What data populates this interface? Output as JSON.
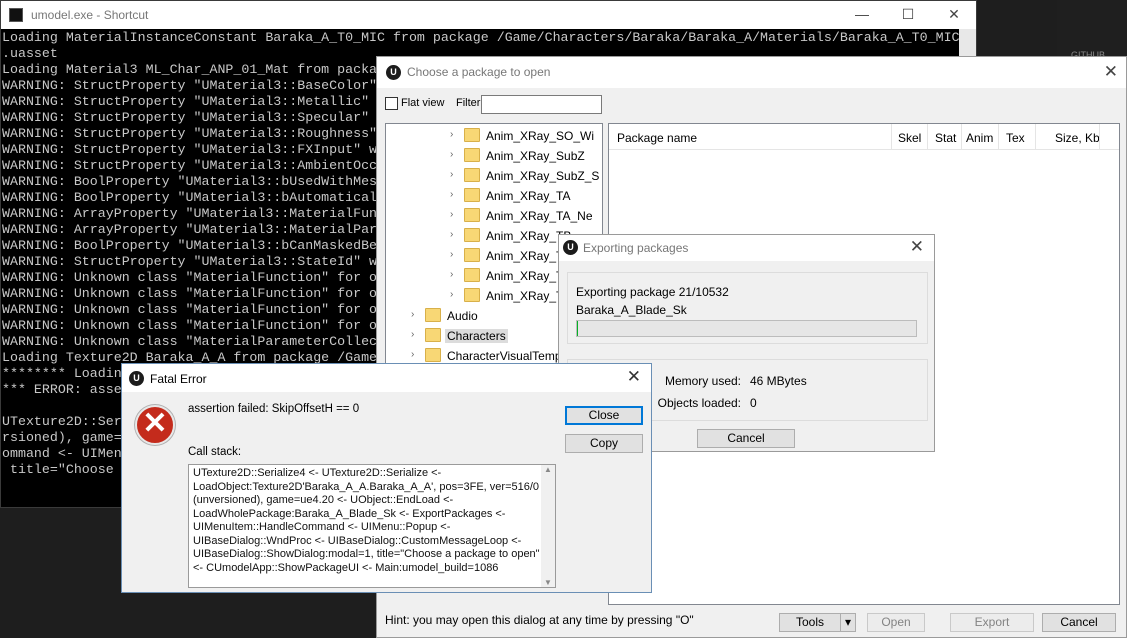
{
  "console": {
    "title": "umodel.exe - Shortcut",
    "controls": {
      "minimize": "—",
      "maximize": "☐",
      "close": "✕"
    },
    "lines": [
      "Loading MaterialInstanceConstant Baraka_A_T0_MIC from package /Game/Characters/Baraka/Baraka_A/Materials/Baraka_A_T0_MIC",
      ".uasset",
      "Loading Material3 ML_Char_ANP_01_Mat from packa",
      "WARNING: StructProperty \"UMaterial3::BaseColor\"",
      "WARNING: StructProperty \"UMaterial3::Metallic\"",
      "WARNING: StructProperty \"UMaterial3::Specular\"",
      "WARNING: StructProperty \"UMaterial3::Roughness\"",
      "WARNING: StructProperty \"UMaterial3::FXInput\" w",
      "WARNING: StructProperty \"UMaterial3::AmbientOcc",
      "WARNING: BoolProperty \"UMaterial3::bUsedWithMes",
      "WARNING: BoolProperty \"UMaterial3::bAutomatical",
      "WARNING: ArrayProperty \"UMaterial3::MaterialFun",
      "WARNING: ArrayProperty \"UMaterial3::MaterialPar",
      "WARNING: BoolProperty \"UMaterial3::bCanMaskedBe",
      "WARNING: StructProperty \"UMaterial3::StateId\" w",
      "WARNING: Unknown class \"MaterialFunction\" for o",
      "WARNING: Unknown class \"MaterialFunction\" for o",
      "WARNING: Unknown class \"MaterialFunction\" for o",
      "WARNING: Unknown class \"MaterialFunction\" for o",
      "WARNING: Unknown class \"MaterialParameterCollec",
      "Loading Texture2D Baraka_A_A from package /Game",
      "******** Loadin",
      "*** ERROR: asse",
      "",
      "UTexture2D::Ser",
      "rsioned), game=",
      "ommand <- UIMen",
      " title=\"Choose"
    ]
  },
  "background": {
    "right_label": "GITHUB"
  },
  "package_dialog": {
    "title": "Choose a package to open",
    "close": "✕",
    "flat_view_label": "Flat view",
    "filter_label": "Filter:",
    "filter_value": "",
    "tree": [
      {
        "label": "Anim_XRay_SO_Wi",
        "level": 1
      },
      {
        "label": "Anim_XRay_SubZ",
        "level": 1
      },
      {
        "label": "Anim_XRay_SubZ_S",
        "level": 1
      },
      {
        "label": "Anim_XRay_TA",
        "level": 1
      },
      {
        "label": "Anim_XRay_TA_Ne",
        "level": 1
      },
      {
        "label": "Anim_XRay_TB",
        "level": 1
      },
      {
        "label": "Anim_XRay_TB",
        "level": 1
      },
      {
        "label": "Anim_XRay_TK",
        "level": 1
      },
      {
        "label": "Anim_XRay_TF",
        "level": 1
      },
      {
        "label": "Audio",
        "level": 0
      },
      {
        "label": "Characters",
        "level": 0,
        "selected": true
      },
      {
        "label": "CharacterVisualTemplat",
        "level": 0
      }
    ],
    "columns": [
      "Package name",
      "Skel",
      "Stat",
      "Anim",
      "Tex",
      "Size, Kb"
    ],
    "hint": "Hint: you may open this dialog at any time by pressing \"O\"",
    "buttons": {
      "tools": "Tools",
      "tools_arrow": "▾",
      "open": "Open",
      "export": "Export",
      "cancel": "Cancel"
    }
  },
  "export_dialog": {
    "title": "Exporting packages",
    "close": "✕",
    "status": "Exporting package 21/10532",
    "current": "Baraka_A_Blade_Sk",
    "progress": 0.002,
    "memory_label": "Memory used:",
    "memory_value": "46 MBytes",
    "objects_label": "Objects loaded:",
    "objects_value": "0",
    "cancel": "Cancel"
  },
  "fatal_dialog": {
    "title": "Fatal Error",
    "close": "✕",
    "message": "assertion failed: SkipOffsetH == 0",
    "callstack_label": "Call stack:",
    "callstack": "UTexture2D::Serialize4 <- UTexture2D::Serialize <-\nLoadObject:Texture2D'Baraka_A_A.Baraka_A_A', pos=3FE, ver=516/0\n(unversioned), game=ue4.20 <- UObject::EndLoad <-\nLoadWholePackage:Baraka_A_Blade_Sk <- ExportPackages <-\nUIMenuItem::HandleCommand <- UIMenu::Popup <-\nUIBaseDialog::WndProc <- UIBaseDialog::CustomMessageLoop <-\nUIBaseDialog::ShowDialog:modal=1, title=\"Choose a package to open\"\n<- CUmodelApp::ShowPackageUI <- Main:umodel_build=1086",
    "buttons": {
      "close": "Close",
      "copy": "Copy"
    },
    "icon": "error-x-icon"
  }
}
